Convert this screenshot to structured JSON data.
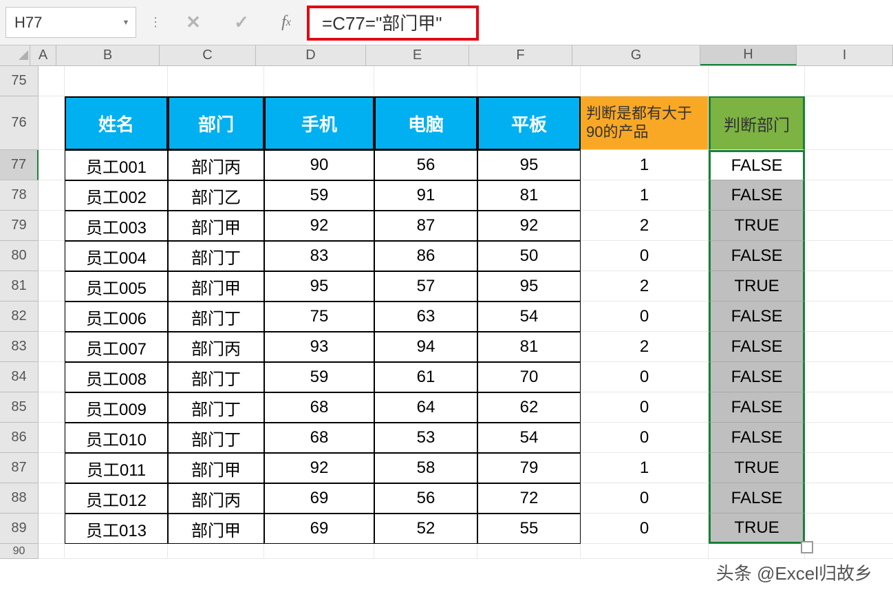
{
  "nameBox": "H77",
  "formula": "=C77=\"部门甲\"",
  "columnHeaders": [
    "A",
    "B",
    "C",
    "D",
    "E",
    "F",
    "G",
    "H",
    "I"
  ],
  "activeCol": "H",
  "rowHeaders": [
    "75",
    "76",
    "77",
    "78",
    "79",
    "80",
    "81",
    "82",
    "83",
    "84",
    "85",
    "86",
    "87",
    "88",
    "89",
    "90"
  ],
  "activeRow": "77",
  "headers": {
    "B": "姓名",
    "C": "部门",
    "D": "手机",
    "E": "电脑",
    "F": "平板",
    "G": "判断是都有大于90的产品",
    "H": "判断部门"
  },
  "data": [
    {
      "name": "员工001",
      "dept": "部门丙",
      "phone": "90",
      "pc": "56",
      "tablet": "95",
      "g": "1",
      "h": "FALSE"
    },
    {
      "name": "员工002",
      "dept": "部门乙",
      "phone": "59",
      "pc": "91",
      "tablet": "81",
      "g": "1",
      "h": "FALSE"
    },
    {
      "name": "员工003",
      "dept": "部门甲",
      "phone": "92",
      "pc": "87",
      "tablet": "92",
      "g": "2",
      "h": "TRUE"
    },
    {
      "name": "员工004",
      "dept": "部门丁",
      "phone": "83",
      "pc": "86",
      "tablet": "50",
      "g": "0",
      "h": "FALSE"
    },
    {
      "name": "员工005",
      "dept": "部门甲",
      "phone": "95",
      "pc": "57",
      "tablet": "95",
      "g": "2",
      "h": "TRUE"
    },
    {
      "name": "员工006",
      "dept": "部门丁",
      "phone": "75",
      "pc": "63",
      "tablet": "54",
      "g": "0",
      "h": "FALSE"
    },
    {
      "name": "员工007",
      "dept": "部门丙",
      "phone": "93",
      "pc": "94",
      "tablet": "81",
      "g": "2",
      "h": "FALSE"
    },
    {
      "name": "员工008",
      "dept": "部门丁",
      "phone": "59",
      "pc": "61",
      "tablet": "70",
      "g": "0",
      "h": "FALSE"
    },
    {
      "name": "员工009",
      "dept": "部门丁",
      "phone": "68",
      "pc": "64",
      "tablet": "62",
      "g": "0",
      "h": "FALSE"
    },
    {
      "name": "员工010",
      "dept": "部门丁",
      "phone": "68",
      "pc": "53",
      "tablet": "54",
      "g": "0",
      "h": "FALSE"
    },
    {
      "name": "员工011",
      "dept": "部门甲",
      "phone": "92",
      "pc": "58",
      "tablet": "79",
      "g": "1",
      "h": "TRUE"
    },
    {
      "name": "员工012",
      "dept": "部门丙",
      "phone": "69",
      "pc": "56",
      "tablet": "72",
      "g": "0",
      "h": "FALSE"
    },
    {
      "name": "员工013",
      "dept": "部门甲",
      "phone": "69",
      "pc": "52",
      "tablet": "55",
      "g": "0",
      "h": "TRUE"
    }
  ],
  "watermark": "头条 @Excel归故乡"
}
